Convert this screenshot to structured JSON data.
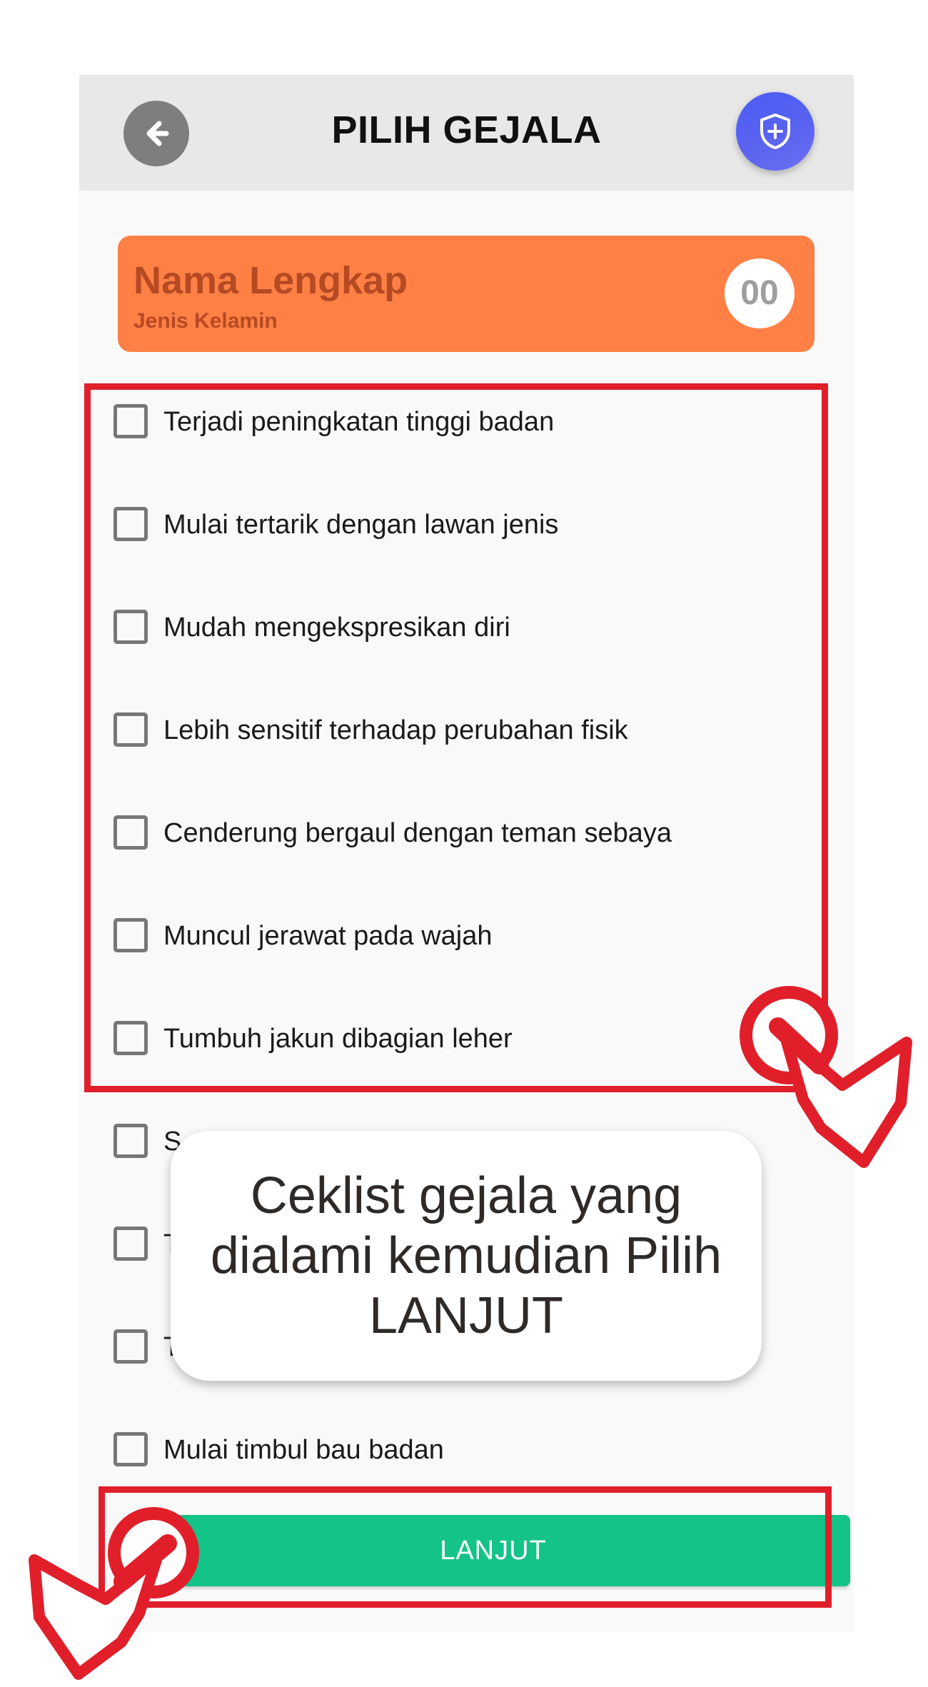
{
  "appbar": {
    "title": "PILIH GEJALA",
    "back_icon": "arrow-left-icon",
    "action_icon": "shield-plus-icon"
  },
  "profile": {
    "name": "Nama Lengkap",
    "gender": "Jenis Kelamin",
    "count": "00"
  },
  "symptoms": [
    {
      "label": "Terjadi peningkatan tinggi badan",
      "checked": false
    },
    {
      "label": "Mulai tertarik dengan lawan jenis",
      "checked": false
    },
    {
      "label": "Mudah mengekspresikan diri",
      "checked": false
    },
    {
      "label": "Lebih sensitif terhadap perubahan fisik",
      "checked": false
    },
    {
      "label": "Cenderung bergaul dengan teman sebaya",
      "checked": false
    },
    {
      "label": "Muncul jerawat pada wajah",
      "checked": false
    },
    {
      "label": "Tumbuh jakun dibagian leher",
      "checked": false
    },
    {
      "label": "S",
      "checked": false
    },
    {
      "label": "T",
      "checked": false
    },
    {
      "label": "T",
      "checked": false
    },
    {
      "label": "Mulai timbul bau badan",
      "checked": false
    }
  ],
  "primary_button": {
    "label": "LANJUT"
  },
  "tooltip": {
    "text": "Ceklist gejala yang dialami kemudian Pilih LANJUT"
  },
  "colors": {
    "accent_orange": "#fe8045",
    "button_green": "#13c388",
    "shield_blue": "#4c5cf7",
    "highlight_red": "#e01f2b"
  }
}
